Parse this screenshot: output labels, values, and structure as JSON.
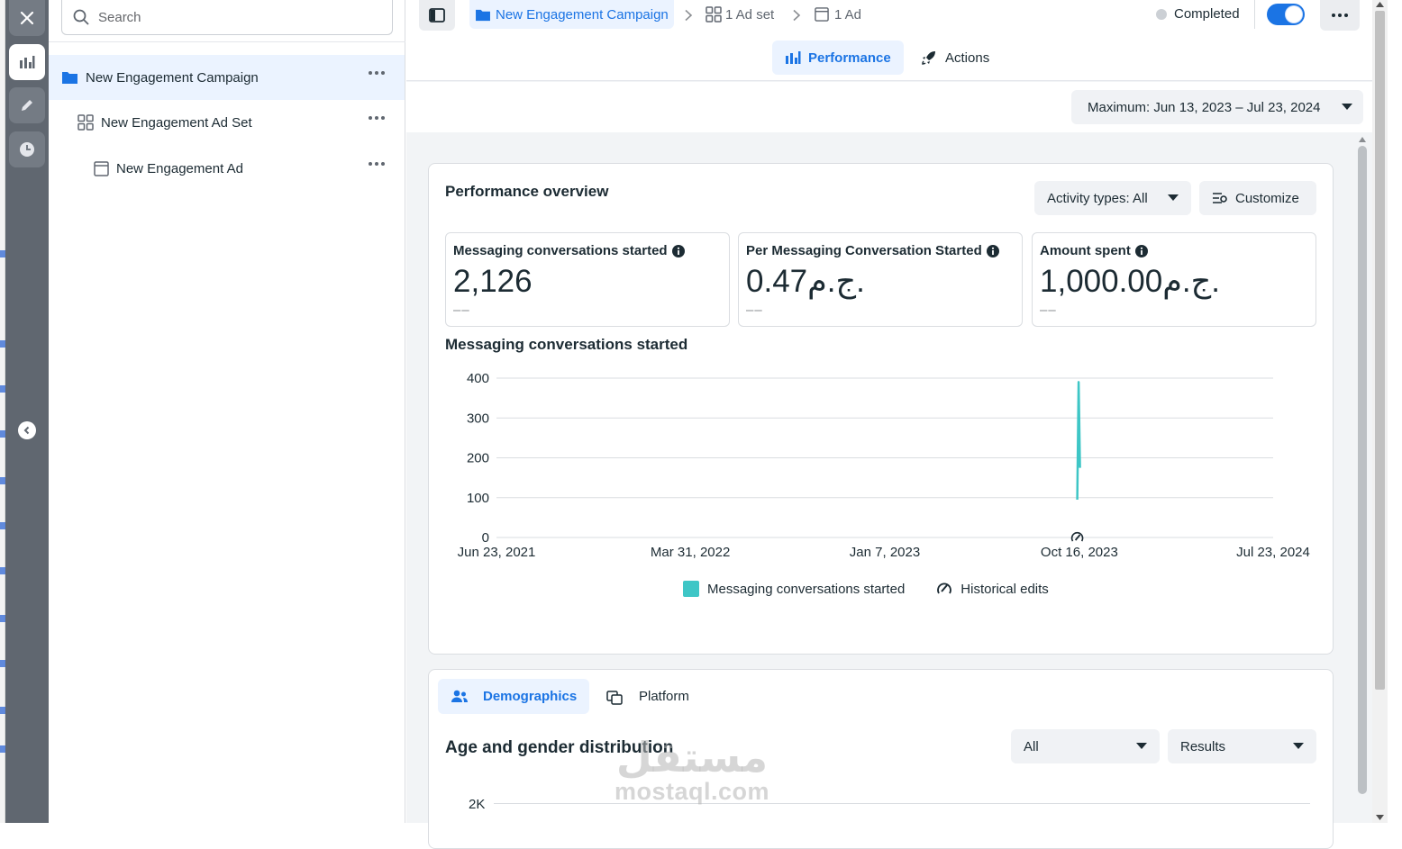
{
  "rail": {
    "close": "close",
    "items": [
      "performance",
      "edit",
      "history"
    ]
  },
  "tree": {
    "search_placeholder": "Search",
    "items": [
      {
        "label": "New Engagement Campaign",
        "icon": "folder-icon",
        "selected": true
      },
      {
        "label": "New Engagement Ad Set",
        "icon": "grid-icon",
        "selected": false
      },
      {
        "label": "New Engagement Ad",
        "icon": "ad-icon",
        "selected": false
      }
    ]
  },
  "header": {
    "breadcrumb": {
      "campaign": "New Engagement Campaign",
      "adset": "1 Ad set",
      "ad": "1 Ad"
    },
    "status": "Completed",
    "toggle_on": true,
    "tabs": {
      "performance": "Performance",
      "actions": "Actions"
    },
    "date_range": "Maximum: Jun 13, 2023 – Jul 23, 2024"
  },
  "overview": {
    "title": "Performance overview",
    "activity_types": "Activity types: All",
    "customize": "Customize",
    "metrics": [
      {
        "label": "Messaging conversations started",
        "value": "2,126",
        "delta": "––"
      },
      {
        "label": "Per Messaging Conversation Started",
        "value": "0.47ج.م.",
        "delta": "––"
      },
      {
        "label": "Amount spent",
        "value": "1,000.00ج.م.",
        "delta": "––"
      }
    ],
    "chart_title": "Messaging conversations started",
    "legend": {
      "series": "Messaging conversations started",
      "edits": "Historical edits"
    }
  },
  "chart_data": {
    "type": "line",
    "title": "Messaging conversations started",
    "x_ticks": [
      "Jun 23, 2021",
      "Mar 31, 2022",
      "Jan 7, 2023",
      "Oct 16, 2023",
      "Jul 23, 2024"
    ],
    "y_ticks": [
      0,
      100,
      200,
      300,
      400
    ],
    "ylim": [
      0,
      400
    ],
    "xlim": [
      "2021-06-23",
      "2024-07-23"
    ],
    "series": [
      {
        "name": "Messaging conversations started",
        "color": "#3ec6c6",
        "points": [
          {
            "x": "2023-10-13",
            "y": 95
          },
          {
            "x": "2023-10-15",
            "y": 390
          },
          {
            "x": "2023-10-17",
            "y": 175
          }
        ]
      }
    ],
    "historical_edit_markers": [
      "2023-10-13"
    ],
    "grid": true
  },
  "demographics": {
    "tabs": {
      "demographics": "Demographics",
      "platform": "Platform"
    },
    "title": "Age and gender distribution",
    "filter_all": "All",
    "filter_results": "Results",
    "axis_top": "2K"
  },
  "watermark": {
    "arabic": "مستقل",
    "latin": "mostaql.com"
  },
  "colors": {
    "accent": "#1b74e4",
    "series": "#3ec6c6",
    "rail": "#606770"
  }
}
